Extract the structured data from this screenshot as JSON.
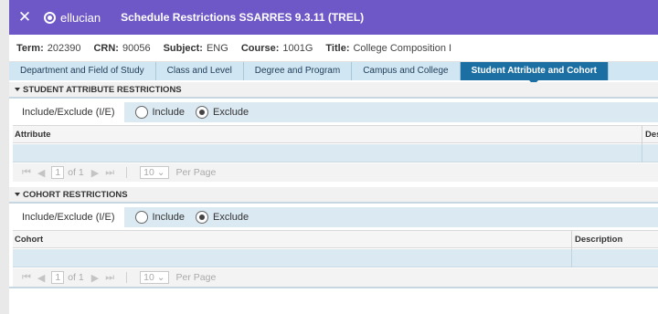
{
  "header": {
    "close_glyph": "✕",
    "logo_text": "ellucian",
    "title": "Schedule Restrictions SSARRES 9.3.11 (TREL)"
  },
  "key_block": {
    "term_label": "Term:",
    "term_value": "202390",
    "crn_label": "CRN:",
    "crn_value": "90056",
    "subject_label": "Subject:",
    "subject_value": "ENG",
    "course_label": "Course:",
    "course_value": "1001G",
    "title_label": "Title:",
    "title_value": "College Composition I"
  },
  "tabs": [
    {
      "label": "Department and Field of Study",
      "active": false
    },
    {
      "label": "Class and Level",
      "active": false
    },
    {
      "label": "Degree and Program",
      "active": false
    },
    {
      "label": "Campus and College",
      "active": false
    },
    {
      "label": "Student Attribute and Cohort",
      "active": true
    }
  ],
  "attribute_section": {
    "header": "STUDENT ATTRIBUTE RESTRICTIONS",
    "ie_label": "Include/Exclude (I/E)",
    "include_label": "Include",
    "exclude_label": "Exclude",
    "selected": "Exclude",
    "columns": [
      "Attribute",
      "Des"
    ]
  },
  "cohort_section": {
    "header": "COHORT RESTRICTIONS",
    "ie_label": "Include/Exclude (I/E)",
    "include_label": "Include",
    "exclude_label": "Exclude",
    "selected": "Exclude",
    "columns": [
      "Cohort",
      "Description"
    ]
  },
  "pager": {
    "page": "1",
    "of_text": "of 1",
    "per_page_value": "10",
    "per_page_label": "Per Page"
  },
  "icons": {
    "first": "first-page-icon",
    "prev": "previous-page-icon",
    "next": "next-page-icon",
    "last": "last-page-icon"
  }
}
